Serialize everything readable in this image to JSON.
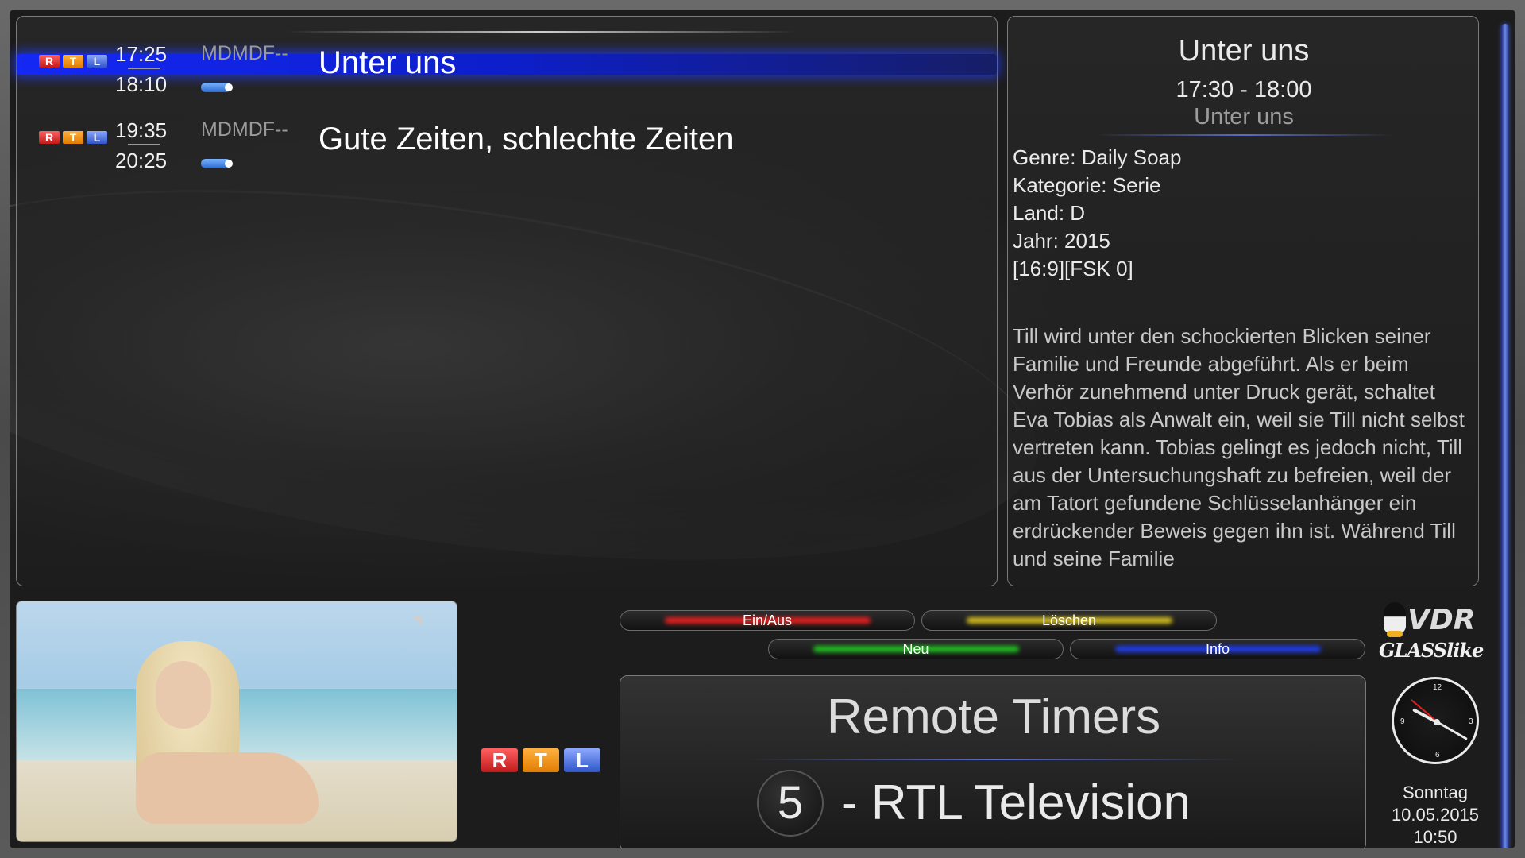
{
  "epg": {
    "rows": [
      {
        "channel_logo": "RTL",
        "start": "17:25",
        "end": "18:10",
        "vps": "MDMDF--",
        "title": "Unter uns",
        "selected": true
      },
      {
        "channel_logo": "RTL",
        "start": "19:35",
        "end": "20:25",
        "vps": "MDMDF--",
        "title": "Gute Zeiten, schlechte Zeiten",
        "selected": false
      }
    ]
  },
  "detail": {
    "title": "Unter uns",
    "time": "17:30 - 18:00",
    "short_text": "Unter uns",
    "meta": [
      "Genre: Daily Soap",
      "Kategorie: Serie",
      "Land: D",
      "Jahr: 2015",
      "[16:9][FSK 0]"
    ],
    "description": "Till wird unter den schockierten Blicken seiner Familie und Freunde abgeführt. Als er beim Verhör zunehmend unter Druck gerät, schaltet Eva Tobias als Anwalt ein, weil sie Till nicht selbst vertreten kann. Tobias gelingt es jedoch nicht, Till aus der Untersuchungshaft zu befreien, weil der am Tatort gefundene Schlüsselanhänger ein erdrückender Beweis gegen ihn ist. Während Till und seine Familie"
  },
  "buttons": {
    "red": "Ein/Aus",
    "yellow": "Löschen",
    "green": "Neu",
    "blue": "Info"
  },
  "colors": {
    "red": "#ff2020",
    "yellow": "#e8d020",
    "green": "#20d020",
    "blue": "#2040ff",
    "selection": "#1428ff"
  },
  "logo": {
    "line1": "VDR",
    "line2": "GLASSlike"
  },
  "timer_panel": {
    "title": "Remote Timers",
    "channel_number": "5",
    "channel_name": "- RTL Television"
  },
  "channel_logo_big": "RTL",
  "clock": {
    "weekday": "Sonntag",
    "date": "10.05.2015",
    "time": "10:50",
    "numerals": [
      "12",
      "3",
      "6",
      "9"
    ]
  },
  "icons": {
    "pip": "pip-corner-icon",
    "tux": "tux-penguin-icon",
    "clock": "analog-clock-icon"
  }
}
